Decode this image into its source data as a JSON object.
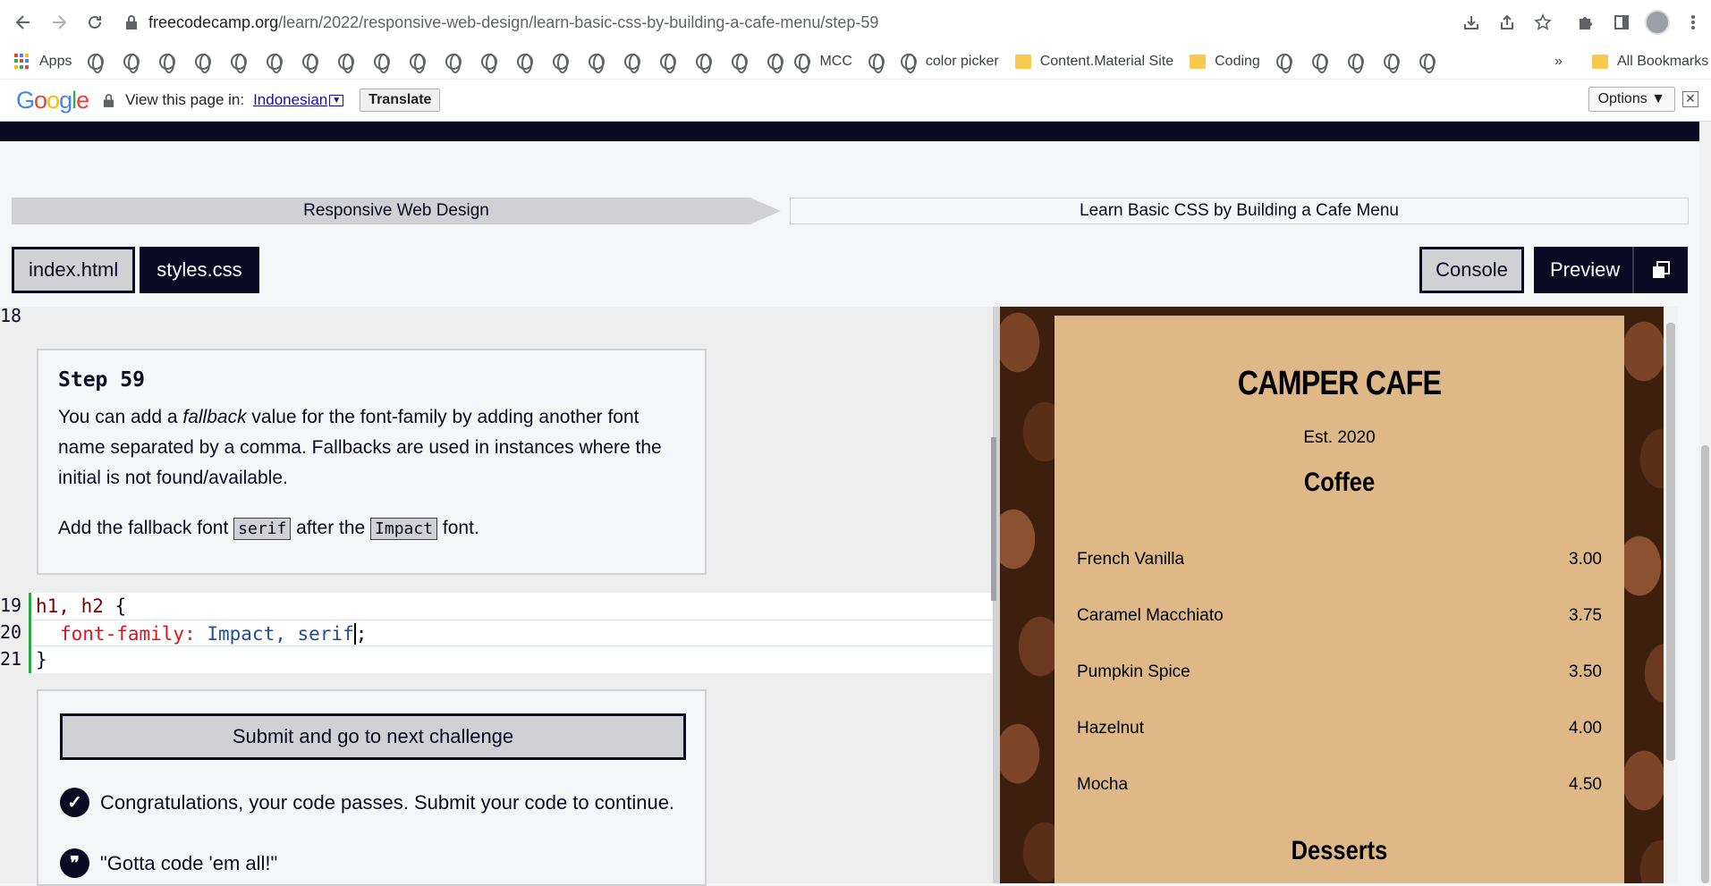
{
  "browser": {
    "url_host": "freecodecamp.org",
    "url_path": "/learn/2022/responsive-web-design/learn-basic-css-by-building-a-cafe-menu/step-59"
  },
  "bookmarks": {
    "apps_label": "Apps",
    "items": [
      "MCC",
      "color picker",
      "Content.Material Site",
      "Coding"
    ],
    "more": "»",
    "all_bookmarks": "All Bookmarks"
  },
  "translate": {
    "logo": "Google",
    "prompt": "View this page in:",
    "language": "Indonesian",
    "translate_btn": "Translate",
    "options_btn": "Options ▼",
    "close": "✕"
  },
  "breadcrumbs": {
    "first": "Responsive Web Design",
    "second": "Learn Basic CSS by Building a Cafe Menu"
  },
  "tabs": {
    "html": "index.html",
    "css": "styles.css",
    "console": "Console",
    "preview": "Preview"
  },
  "editor": {
    "line_numbers": [
      "18",
      "19",
      "20",
      "21"
    ],
    "step_title": "Step 59",
    "para1_a": "You can add a ",
    "para1_em": "fallback",
    "para1_b": " value for the font-family by adding another font name separated by a comma. Fallbacks are used in instances where the initial is not found/available.",
    "para2_a": "Add the fallback font ",
    "para2_code1": "serif",
    "para2_b": " after the ",
    "para2_code2": "Impact",
    "para2_c": " font.",
    "code": {
      "line19_sel": "h1, h2",
      "line19_brace": " {",
      "line20_prop": "font-family:",
      "line20_val": " Impact, serif",
      "line20_end": ";",
      "line21": "}"
    },
    "submit_label": "Submit and go to next challenge",
    "success_msg": "Congratulations, your code passes. Submit your code to continue.",
    "quote": "\"Gotta code 'em all!\""
  },
  "preview": {
    "title": "CAMPER CAFE",
    "est": "Est. 2020",
    "section1": "Coffee",
    "items": [
      {
        "name": "French Vanilla",
        "price": "3.00"
      },
      {
        "name": "Caramel Macchiato",
        "price": "3.75"
      },
      {
        "name": "Pumpkin Spice",
        "price": "3.50"
      },
      {
        "name": "Hazelnut",
        "price": "4.00"
      },
      {
        "name": "Mocha",
        "price": "4.50"
      }
    ],
    "section2": "Desserts"
  }
}
